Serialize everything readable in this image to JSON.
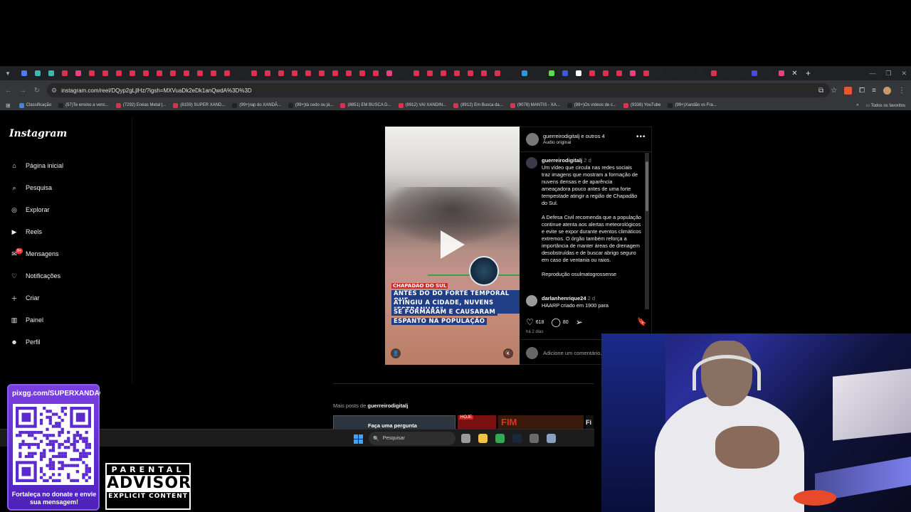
{
  "browser": {
    "url": "instagram.com/reel/DQyp2gLjlHz/?igsh=MXVuaDk2eDk1anQwdA%3D%3D",
    "tab_colors": [
      "#4a7ef0",
      "#3fb8af",
      "#3fb8af",
      "#e03050",
      "#e8417c",
      "#e03050",
      "#e03050",
      "#e03050",
      "#e03050",
      "#e03050",
      "#e03050",
      "#e03050",
      "#e03050",
      "#e03050",
      "#e03050",
      "#e03050",
      "#222222",
      "#e03050",
      "#e03050",
      "#e03050",
      "#e03050",
      "#e03050",
      "#e03050",
      "#e03050",
      "#e03050",
      "#e03050",
      "#e03050",
      "#e8417c",
      "#222222",
      "#e03050",
      "#e03050",
      "#e03050",
      "#e03050",
      "#e03050",
      "#e03050",
      "#e03050",
      "#222222",
      "#2a9ad8",
      "#222222",
      "#53e04a",
      "#3b5bd8",
      "#ffffff",
      "#e03050",
      "#e03050",
      "#e03050",
      "#e8417c",
      "#e03050",
      "#222222",
      "#222222",
      "#222222",
      "#222222",
      "#e03050",
      "#222222",
      "#222222",
      "#4a4ae0",
      "#222222",
      "#e8417c"
    ],
    "bookmarks": [
      {
        "label": "Classificação",
        "color": "#4a7ef0"
      },
      {
        "label": "(57)Te ensino a venc...",
        "color": "#222222"
      },
      {
        "label": "(7292) Enéas Metal |...",
        "color": "#e03050"
      },
      {
        "label": "(8159) SUPER XAND...",
        "color": "#e03050"
      },
      {
        "label": "(99+)rap do XANDÃ...",
        "color": "#222222"
      },
      {
        "label": "(99+)tá cedo ou já...",
        "color": "#222222"
      },
      {
        "label": "(8851) EM BUSCA D...",
        "color": "#e03050"
      },
      {
        "label": "(8912) VAI XANDIN...",
        "color": "#e03050"
      },
      {
        "label": "(8912) Em Busca da...",
        "color": "#e03050"
      },
      {
        "label": "(9078) MANTIS - XA...",
        "color": "#e03050"
      },
      {
        "label": "(99+)Os vídeos de c...",
        "color": "#222222"
      },
      {
        "label": "(9338) YouTube",
        "color": "#e03050"
      },
      {
        "label": "(99+)Xandão vs Fra...",
        "color": "#222222"
      }
    ],
    "all_bookmarks": "Todos os favoritos"
  },
  "instagram": {
    "logo": "Instagram",
    "nav": [
      {
        "label": "Página inicial",
        "icon": "home-icon"
      },
      {
        "label": "Pesquisa",
        "icon": "search-icon"
      },
      {
        "label": "Explorar",
        "icon": "compass-icon"
      },
      {
        "label": "Reels",
        "icon": "reels-icon"
      },
      {
        "label": "Mensagens",
        "icon": "messenger-icon",
        "badge": "9+"
      },
      {
        "label": "Notificações",
        "icon": "heart-icon"
      },
      {
        "label": "Criar",
        "icon": "plus-icon"
      },
      {
        "label": "Painel",
        "icon": "chart-icon"
      },
      {
        "label": "Perfil",
        "icon": "profile-icon"
      }
    ],
    "video": {
      "tag": "CHAPADÃO DO SUL",
      "caption_lines": [
        "ANTES DO DO FORTE TEMPORAL QUE",
        "ATINGIU A CIDADE, NUVENS \"ESTRANHAS\"",
        "SE FORMARAM E CAUSARAM",
        "ESPANTO NA POPULAÇÃO"
      ]
    },
    "post": {
      "header_user": "guerreirodigitalj e outros 4",
      "audio": "Áudio original",
      "caption_user": "guerreirodigitalj",
      "caption_time": "2 d",
      "caption_paragraphs": [
        "Um vídeo que circula nas redes sociais traz imagens que mostram a formação de nuvens densas e de aparência ameaçadora pouco antes de uma forte tempestade atingir a região de Chapadão do Sul.",
        "A Defesa Civil recomenda que a população continue atenta aos alertas meteorológicos e evite se expor durante eventos climáticos extremos. O órgão também reforça a importância de manter áreas de drenagem desobstruídas e de buscar abrigo seguro em caso de ventania ou raios.",
        "Reprodução osulmatogrossense"
      ],
      "comment_user": "darlanhenrique24",
      "comment_time": "2 d",
      "comment_text": "HAARP criado em 1900 para",
      "likes": "618",
      "comments": "80",
      "ago": "há 2 dias",
      "add_comment": "Adicione um comentário..."
    },
    "more_posts_prefix": "Mais posts de ",
    "more_posts_user": "guerreirodigitalj",
    "thumb1_text": "Faça uma pergunta",
    "thumb2_text": "HOJE",
    "thumb3_text": "FIM",
    "thumb4_text": "Fi"
  },
  "taskbar": {
    "search_placeholder": "Pesquisar",
    "apps": [
      {
        "name": "task-view",
        "color": "#9a9a9a"
      },
      {
        "name": "file-explorer",
        "color": "#f2c14a"
      },
      {
        "name": "chrome",
        "color": "#34a853"
      },
      {
        "name": "steam",
        "color": "#1b2838"
      },
      {
        "name": "obs",
        "color": "#6a6a6a"
      },
      {
        "name": "settings",
        "color": "#8aa0c0"
      }
    ]
  },
  "overlay": {
    "qr_url": "pixgg.com/SUPERXANDÃO",
    "qr_caption": "Fortaleça no donate e envie sua mensagem!",
    "parental_l1": "PARENTAL",
    "parental_l2": "ADVISORY",
    "parental_l3": "EXPLICIT CONTENT"
  }
}
